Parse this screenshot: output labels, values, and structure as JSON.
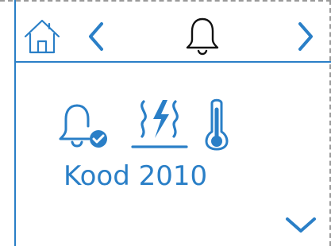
{
  "colors": {
    "accent": "#2a7fc7",
    "foreground": "#111111",
    "border_dashed": "#9a9a9a",
    "background": "#ffffff"
  },
  "header": {
    "home_icon": "home-icon",
    "back_icon": "chevron-left-icon",
    "center_icon": "bell-icon",
    "forward_icon": "chevron-right-icon"
  },
  "status": {
    "icons": [
      "bell-check-icon",
      "floor-heating-icon",
      "thermometer-icon"
    ],
    "code_label": "Kood 2010"
  },
  "footer": {
    "more_icon": "chevron-down-icon"
  }
}
